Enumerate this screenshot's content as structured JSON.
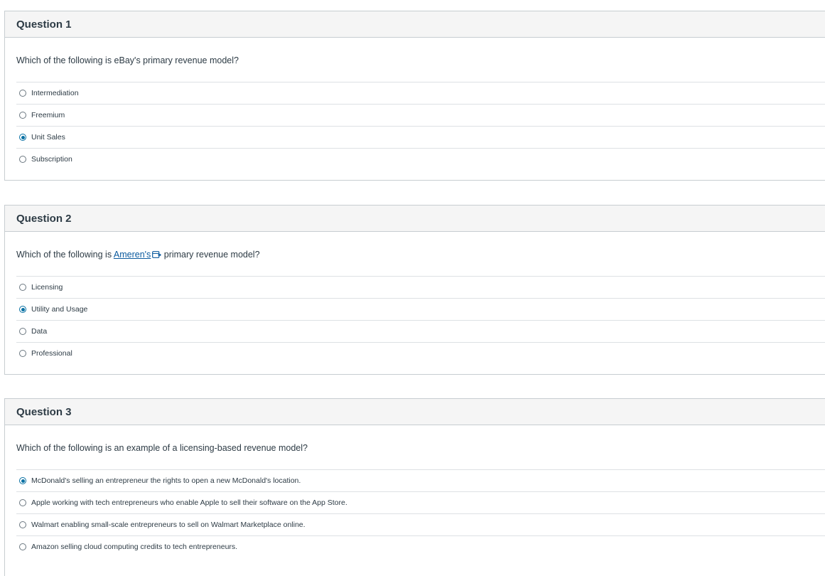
{
  "colors": {
    "header_bg": "#f5f5f5",
    "border": "#c7cdd1",
    "selected_radio": "#0770a3",
    "link": "#0b5a9e"
  },
  "questions": [
    {
      "title": "Question 1",
      "text_before": "Which of the following is eBay's primary revenue model?",
      "answers": [
        {
          "label": "Intermediation",
          "selected": false
        },
        {
          "label": "Freemium",
          "selected": false
        },
        {
          "label": "Unit Sales",
          "selected": true
        },
        {
          "label": "Subscription",
          "selected": false
        }
      ]
    },
    {
      "title": "Question 2",
      "text_before": "Which of the following is ",
      "link_text": "Ameren's",
      "link_icon": "external-link-icon",
      "text_after": " primary revenue model?",
      "answers": [
        {
          "label": "Licensing",
          "selected": false
        },
        {
          "label": "Utility and Usage",
          "selected": true
        },
        {
          "label": "Data",
          "selected": false
        },
        {
          "label": "Professional",
          "selected": false
        }
      ]
    },
    {
      "title": "Question 3",
      "text_before": "Which of the following is an example of a licensing-based revenue model?",
      "answers": [
        {
          "label": "McDonald's selling an entrepreneur the rights to open a new McDonald's location.",
          "selected": true
        },
        {
          "label": "Apple working with tech entrepreneurs who enable Apple to sell their software on the App Store.",
          "selected": false
        },
        {
          "label": "Walmart enabling small-scale entrepreneurs to sell on Walmart Marketplace online.",
          "selected": false
        },
        {
          "label": "Amazon selling cloud computing credits to tech entrepreneurs.",
          "selected": false
        }
      ]
    }
  ]
}
